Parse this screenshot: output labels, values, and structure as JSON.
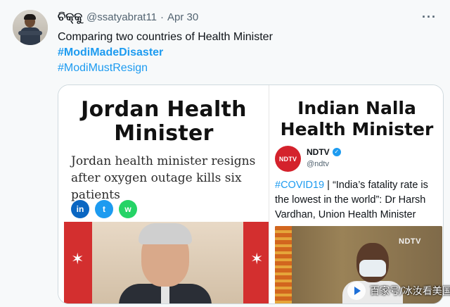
{
  "tweet": {
    "display_name": "ଚିକ୍କୁ",
    "handle": "@ssatyabrat11",
    "separator": "·",
    "date": "Apr 30",
    "more_label": "···",
    "text": "Comparing two countries of Health Minister",
    "hashtags": [
      "#ModiMadeDisaster",
      "#ModiMustResign"
    ]
  },
  "media": {
    "left": {
      "title": "Jordan Health Minister",
      "headline": "Jordan health minister resigns after oxygen outage kills six patients",
      "share_icons": [
        "linkedin-icon",
        "twitter-icon",
        "whatsapp-icon"
      ],
      "share_labels": [
        "in",
        "t",
        "w"
      ]
    },
    "right": {
      "title": "Indian Nalla Health Minister",
      "account_logo": "NDTV",
      "account_name": "NDTV",
      "account_handle": "@ndtv",
      "quote_tag": "#COVID19",
      "quote_text": " | “India’s fatality rate is the lowest in the world”: Dr Harsh Vardhan, Union Health Minister",
      "video_logo": "NDTV"
    }
  },
  "watermark": {
    "text": "百家号/冰汝看美国"
  },
  "colors": {
    "accent": "#1d9bf0",
    "ndtv_red": "#d4222c",
    "background": "#f7f9fa"
  }
}
